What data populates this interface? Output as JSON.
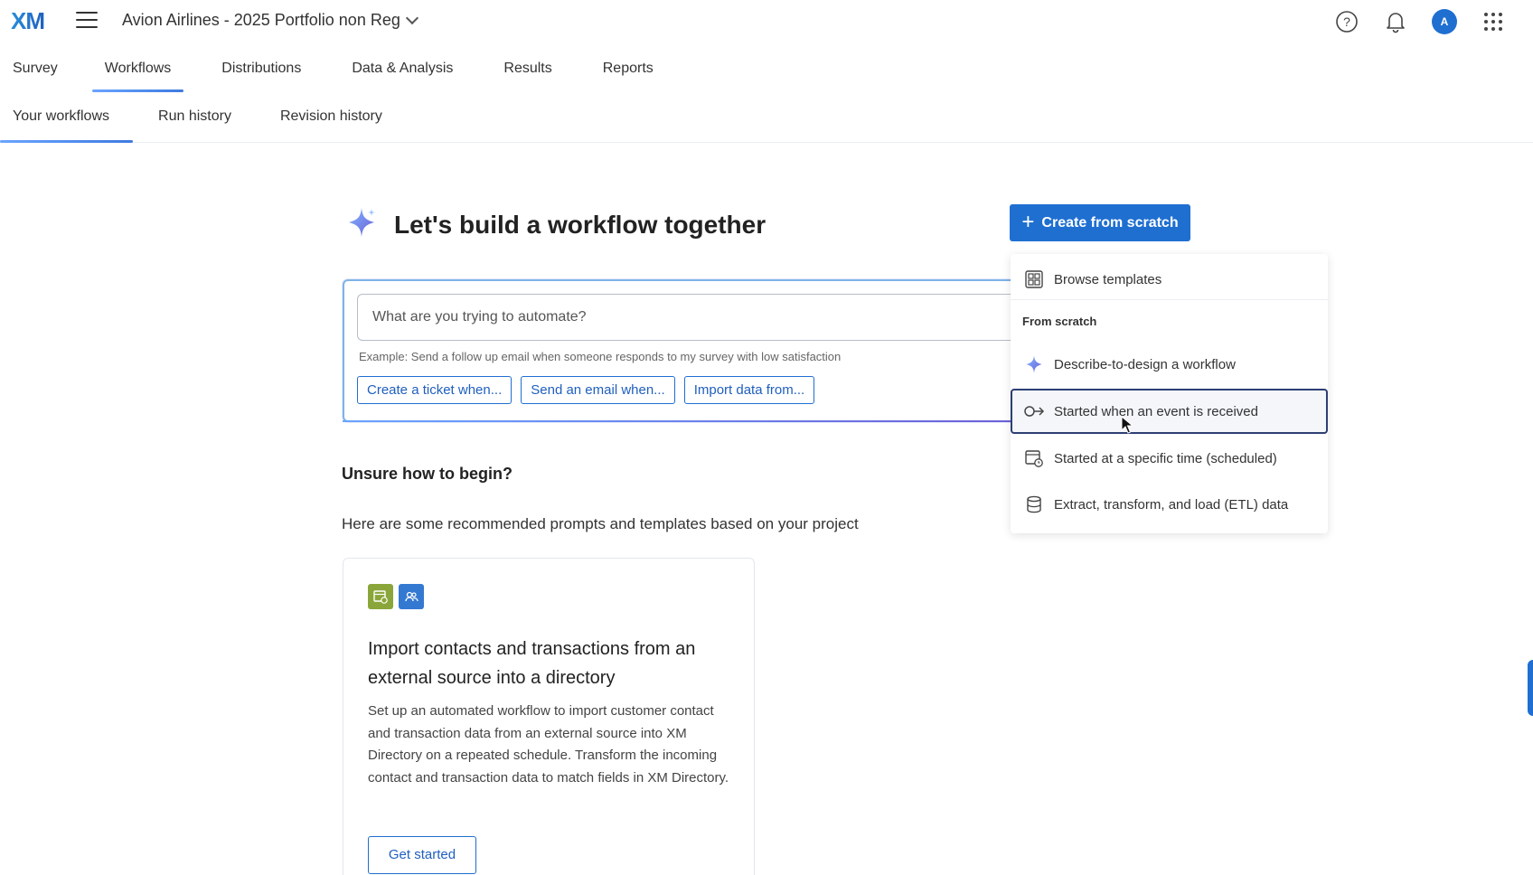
{
  "app": {
    "logo_text": "XM",
    "project_title": "Avion Airlines - 2025 Portfolio non Reg",
    "avatar_initial": "A",
    "accent_color": "#1f6fd1"
  },
  "primary_tabs": [
    {
      "label": "Survey",
      "active": false
    },
    {
      "label": "Workflows",
      "active": true
    },
    {
      "label": "Distributions",
      "active": false
    },
    {
      "label": "Data & Analysis",
      "active": false
    },
    {
      "label": "Results",
      "active": false
    },
    {
      "label": "Reports",
      "active": false
    }
  ],
  "secondary_tabs": [
    {
      "label": "Your workflows",
      "active": true
    },
    {
      "label": "Run history",
      "active": false
    },
    {
      "label": "Revision history",
      "active": false
    }
  ],
  "hero": {
    "title": "Let's build a workflow together",
    "create_button": "Create from scratch"
  },
  "prompt": {
    "placeholder": "What are you trying to automate?",
    "example": "Example: Send a follow up email when someone responds to my survey with low satisfaction",
    "chips": [
      "Create a ticket when...",
      "Send an email when...",
      "Import data from..."
    ]
  },
  "guidance": {
    "heading": "Unsure how to begin?",
    "subtext": "Here are some recommended prompts and templates based on your project"
  },
  "recommendation_card": {
    "title": "Import contacts and transactions from an external source into a directory",
    "description": "Set up an automated workflow to import customer contact and transaction data from an external source into XM Directory on a repeated schedule. Transform the incoming contact and transaction data to match fields in XM Directory.",
    "button": "Get started"
  },
  "menu": {
    "browse_templates": "Browse templates",
    "section_label": "From scratch",
    "items": [
      {
        "label": "Describe-to-design a workflow",
        "icon": "sparkle-icon"
      },
      {
        "label": "Started when an event is received",
        "icon": "event-trigger-icon",
        "highlighted": true
      },
      {
        "label": "Started at a specific time (scheduled)",
        "icon": "calendar-clock-icon"
      },
      {
        "label": "Extract, transform, and load (ETL) data",
        "icon": "database-icon"
      }
    ]
  }
}
